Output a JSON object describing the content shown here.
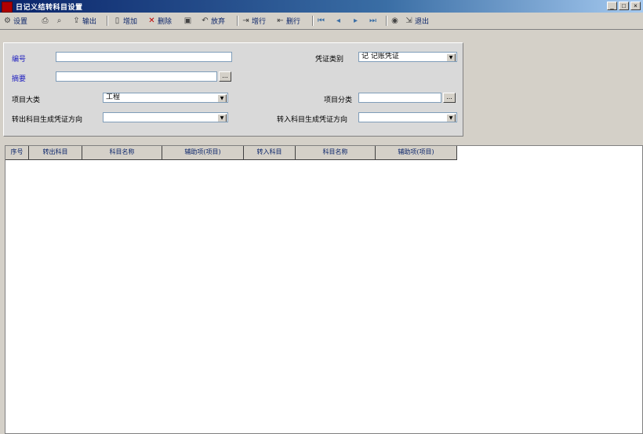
{
  "window": {
    "title": "日记义结转科目设置",
    "buttons": [
      "_",
      "□",
      "×"
    ]
  },
  "toolbar": {
    "settings": "设置",
    "preview": "输出",
    "add": "增加",
    "delete": "删除",
    "undo": "放弃",
    "add_row": "增行",
    "delete_row": "删行",
    "exit": "退出"
  },
  "form": {
    "code_label": "编号",
    "code_value": "",
    "summary_label": "摘要",
    "summary_value": "",
    "summary_button": "...",
    "voucher_type_label": "凭证类别",
    "voucher_type_value": "记 记账凭证",
    "project_category_label": "项目大类",
    "project_category_value": "工程",
    "project_class_label": "项目分类",
    "project_class_value": "",
    "project_class_button": "...",
    "out_direction_label": "转出科目生成凭证方向",
    "out_direction_value": "",
    "in_direction_label": "转入科目生成凭证方向",
    "in_direction_value": ""
  },
  "grid": {
    "columns": [
      "序号",
      "转出科目",
      "科目名称",
      "辅助项(项目)",
      "转入科目",
      "科目名称",
      "辅助项(项目)"
    ]
  }
}
